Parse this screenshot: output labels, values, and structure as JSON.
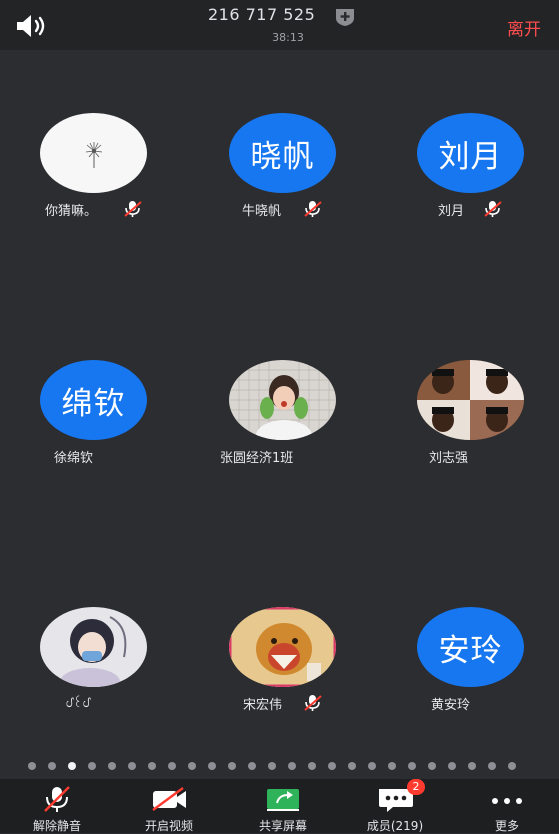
{
  "header": {
    "meeting_id": "216 717 525",
    "timer": "38:13",
    "leave_label": "离开"
  },
  "participants": [
    {
      "name": "你猜嘛。",
      "avatar_type": "image",
      "muted": true
    },
    {
      "name": "牛晓帆",
      "avatar_text": "晓帆",
      "avatar_type": "text",
      "muted": true
    },
    {
      "name": "刘月",
      "avatar_text": "刘月",
      "avatar_type": "text",
      "muted": true
    },
    {
      "name": "徐绵钦",
      "avatar_text": "绵钦",
      "avatar_type": "text",
      "muted": false
    },
    {
      "name": "张圆经济1班",
      "avatar_type": "image",
      "muted": false
    },
    {
      "name": "刘志强",
      "avatar_type": "image",
      "muted": false
    },
    {
      "name": "ᦔ꒰ᦔ",
      "avatar_type": "image",
      "muted": false
    },
    {
      "name": "宋宏伟",
      "avatar_type": "image",
      "muted": true
    },
    {
      "name": "黄安玲",
      "avatar_text": "安玲",
      "avatar_type": "text",
      "muted": false
    }
  ],
  "pager": {
    "active_page": 3
  },
  "toolbar": {
    "unmute_label": "解除静音",
    "video_label": "开启视频",
    "share_label": "共享屏幕",
    "members_label": "成员(219)",
    "members_badge": "2",
    "more_label": "更多"
  },
  "colors": {
    "avatar_blue": "#1677f0",
    "leave_red": "#ff4d4f",
    "share_green": "#2fb35a"
  }
}
